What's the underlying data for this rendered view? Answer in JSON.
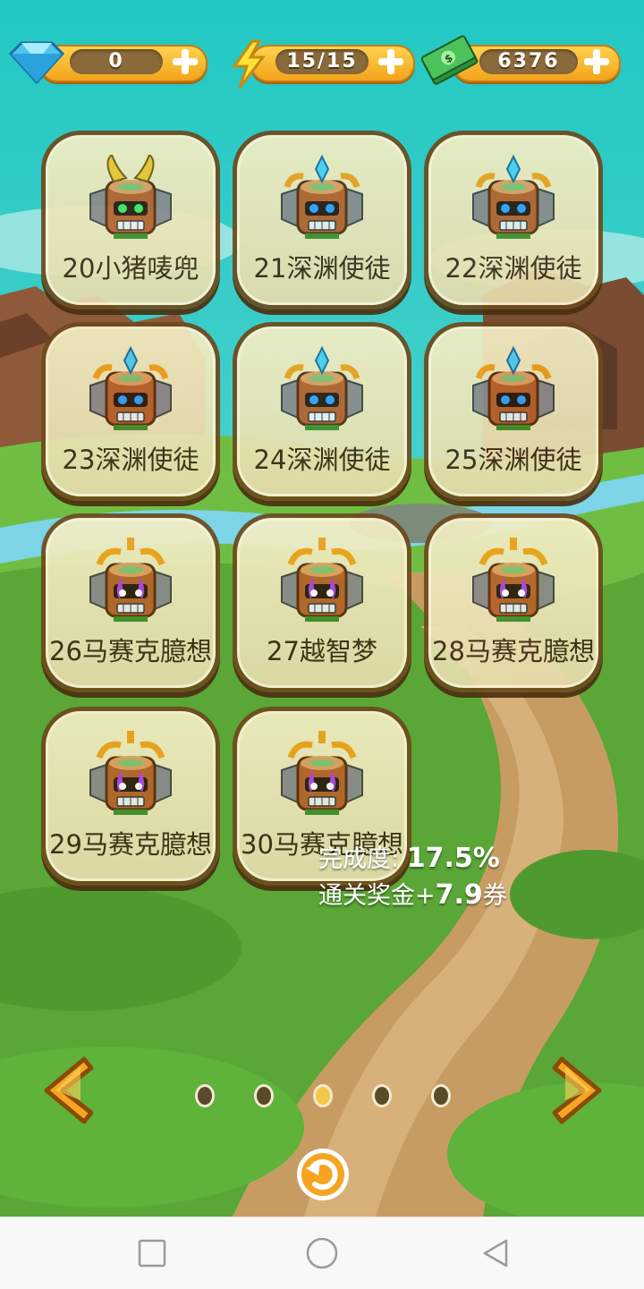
{
  "resources": {
    "gems": "0",
    "energy": "15/15",
    "cash": "6376"
  },
  "levels": [
    {
      "label": "20小猪唛兜",
      "mask": "horned-green-mask-icon"
    },
    {
      "label": "21深渊使徒",
      "mask": "blue-crystal-mask-icon"
    },
    {
      "label": "22深渊使徒",
      "mask": "blue-crystal-mask-icon"
    },
    {
      "label": "23深渊使徒",
      "mask": "blue-crystal-mask-icon"
    },
    {
      "label": "24深渊使徒",
      "mask": "blue-crystal-mask-icon"
    },
    {
      "label": "25深渊使徒",
      "mask": "blue-crystal-mask-icon"
    },
    {
      "label": "26马赛克臆想",
      "mask": "purple-flame-mask-icon"
    },
    {
      "label": "27越智梦",
      "mask": "purple-flame-mask-icon"
    },
    {
      "label": "28马赛克臆想",
      "mask": "purple-flame-mask-icon"
    },
    {
      "label": "29马赛克臆想",
      "mask": "purple-flame-mask-icon"
    },
    {
      "label": "30马赛克臆想",
      "mask": "purple-flame-mask-icon"
    }
  ],
  "progress": {
    "completion_label": "完成度:",
    "completion_value": "17.5%",
    "reward_label": "通关奖金+",
    "reward_value": "7.9",
    "reward_unit": "券"
  },
  "pager": {
    "total_pages": 5,
    "active_page": 3
  },
  "colors": {
    "sky": "#3cc9c4",
    "grass": "#5fae3a",
    "path": "#c9a069",
    "tile_border": "#6d4a1d",
    "gold": "#f3a31b"
  },
  "nav": [
    "recent-apps",
    "home",
    "back"
  ]
}
